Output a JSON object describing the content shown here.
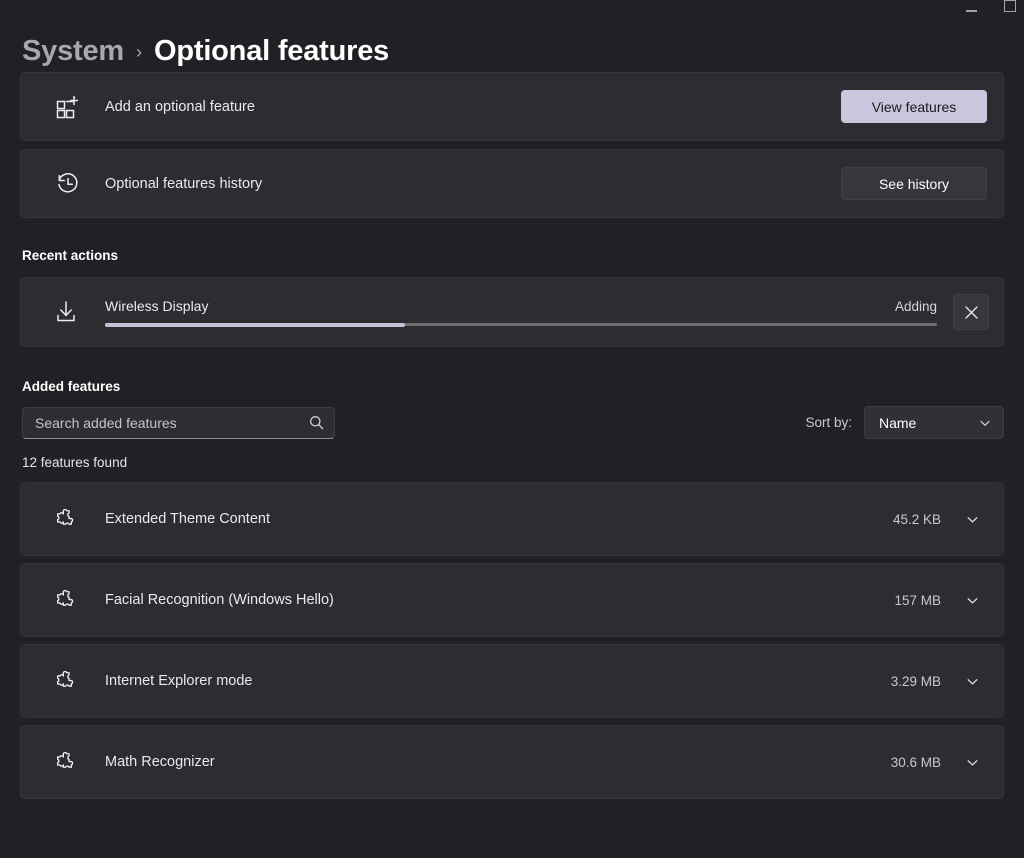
{
  "window": {
    "controls": [
      {
        "name": "minimize",
        "glyph": "minimize-icon"
      },
      {
        "name": "maximize",
        "glyph": "maximize-icon"
      }
    ]
  },
  "breadcrumb": {
    "parent": "System",
    "separator": "›",
    "current": "Optional features"
  },
  "cards": [
    {
      "icon": "add-feature-grid-icon",
      "label": "Add an optional feature",
      "button": "View features",
      "button_style": "accent"
    },
    {
      "icon": "history-clock-icon",
      "label": "Optional features history",
      "button": "See history",
      "button_style": "standard"
    }
  ],
  "recent_actions": {
    "heading": "Recent actions",
    "item": {
      "icon": "download-icon",
      "name": "Wireless Display",
      "status": "Adding",
      "progress_percent": 36,
      "cancel_icon": "close-icon"
    }
  },
  "added_features": {
    "heading": "Added features",
    "search": {
      "placeholder": "Search added features",
      "value": "",
      "icon": "search-icon"
    },
    "sort": {
      "label": "Sort by:",
      "value": "Name",
      "icon": "chevron-down-icon"
    },
    "count_text": "12 features found",
    "items": [
      {
        "icon": "puzzle-piece-icon",
        "name": "Extended Theme Content",
        "size": "45.2 KB",
        "expander": "chevron-down-icon"
      },
      {
        "icon": "puzzle-piece-icon",
        "name": "Facial Recognition (Windows Hello)",
        "size": "157 MB",
        "expander": "chevron-down-icon"
      },
      {
        "icon": "puzzle-piece-icon",
        "name": "Internet Explorer mode",
        "size": "3.29 MB",
        "expander": "chevron-down-icon"
      },
      {
        "icon": "puzzle-piece-icon",
        "name": "Math Recognizer",
        "size": "30.6 MB",
        "expander": "chevron-down-icon"
      }
    ]
  },
  "colors": {
    "page_background": "#1f2125",
    "card_background": "#2b2d31",
    "accent": "#cbc5de",
    "accent_text": "#1b1b1b",
    "progress_fill": "#c5bfd8",
    "text_primary": "#ffffff",
    "text_secondary": "#a6a8ac"
  }
}
